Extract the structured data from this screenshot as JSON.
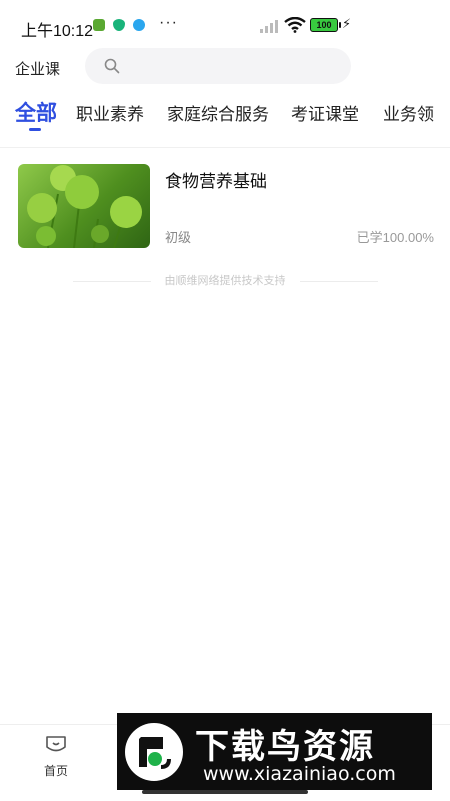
{
  "status_bar": {
    "time": "上午10:12",
    "more": "···",
    "battery": "100"
  },
  "header": {
    "brand": "企业课",
    "search_placeholder": ""
  },
  "tabs": [
    {
      "label": "全部",
      "active": true
    },
    {
      "label": "职业素养",
      "active": false
    },
    {
      "label": "家庭综合服务",
      "active": false
    },
    {
      "label": "考证课堂",
      "active": false
    },
    {
      "label": "业务领",
      "active": false
    }
  ],
  "courses": [
    {
      "title": "食物营养基础",
      "level": "初级",
      "progress": "已学100.00%"
    }
  ],
  "footer_note": "由顺维网络提供技术支持",
  "bottom_nav": {
    "home_label": "首页"
  },
  "watermark": {
    "title": "下载鸟资源",
    "url": "www.xiazainiao.com"
  },
  "colors": {
    "accent": "#2f4fe0",
    "battery": "#38c93f"
  }
}
